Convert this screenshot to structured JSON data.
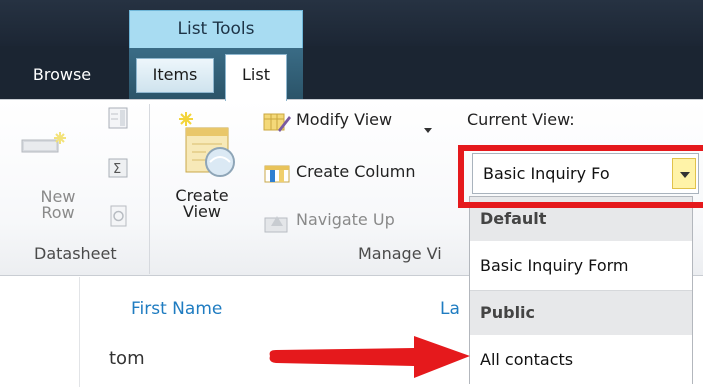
{
  "contextual_tab_group": {
    "label": "List Tools"
  },
  "tabs": [
    {
      "label": "Browse"
    },
    {
      "label": "Items"
    },
    {
      "label": "List"
    }
  ],
  "datasheet_group": {
    "new_row_label_line1": "New",
    "new_row_label_line2": "Row",
    "group_label": "Datasheet"
  },
  "manage_views_group": {
    "create_view_line1": "Create",
    "create_view_line2": "View",
    "modify_view": "Modify View",
    "create_column": "Create Column",
    "navigate_up": "Navigate Up",
    "group_label": "Manage Vi"
  },
  "current_view": {
    "label": "Current View:",
    "selected": "Basic Inquiry Fo",
    "highlight_color": "#e5191c"
  },
  "view_dropdown": {
    "default_header": "Default",
    "default_item": "Basic Inquiry Form",
    "public_header": "Public",
    "public_item": "All contacts"
  },
  "list": {
    "column_first_name": "First Name",
    "column_last_partial": "La",
    "first_row_value": "tom"
  },
  "annotation": {
    "arrow_color": "#e5191c"
  },
  "icons": [
    "new-row-icon",
    "datasheet-view-icon",
    "totals-icon",
    "refresh-data-icon",
    "create-view-icon",
    "modify-view-icon",
    "create-column-icon",
    "navigate-up-icon",
    "dropdown-arrow-icon",
    "red-arrow-icon"
  ]
}
